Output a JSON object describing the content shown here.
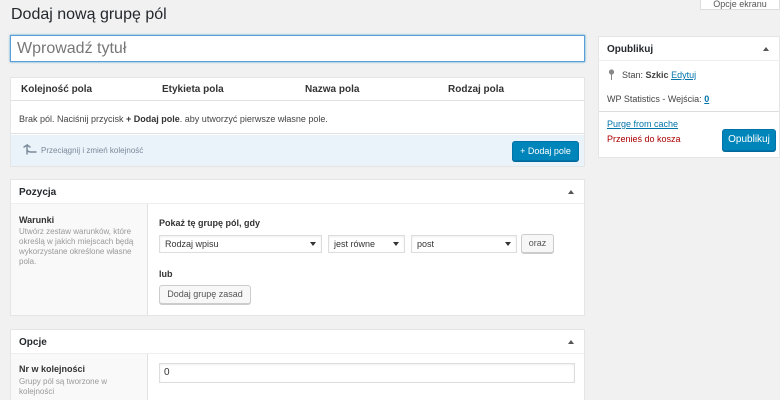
{
  "screen_options": "Opcje ekranu",
  "page_title": "Dodaj nową grupę pól",
  "title_input": {
    "placeholder": "Wprowadź tytuł"
  },
  "fields_table": {
    "columns": [
      "Kolejność pola",
      "Etykieta pola",
      "Nazwa pola",
      "Rodzaj pola"
    ],
    "empty_prefix": "Brak pól. Naciśnij przycisk ",
    "empty_bold": "+ Dodaj pole",
    "empty_suffix": ". aby utworzyć pierwsze własne pole.",
    "reorder_hint": "Przeciągnij i zmień kolejność",
    "add_button": "+ Dodaj pole"
  },
  "location": {
    "title": "Pozycja",
    "rules_label": "Warunki",
    "rules_desc": "Utwórz zestaw warunków, które określą w jakich miejscach będą wykorzystane określone własne pola.",
    "show_if": "Pokaż tę grupę pól, gdy",
    "param_select": "Rodzaj wpisu",
    "operator_select": "jest równe",
    "value_select": "post",
    "and_button": "oraz",
    "or_label": "lub",
    "add_group_button": "Dodaj grupę zasad"
  },
  "options": {
    "title": "Opcje",
    "order_label": "Nr w kolejności",
    "order_desc": "Grupy pól są tworzone w kolejności",
    "order_value": "0"
  },
  "publish": {
    "title": "Opublikuj",
    "status_label": "Stan:",
    "status_value": "Szkic",
    "status_edit": "Edytuj",
    "wp_stats_label": "WP Statistics - Wejścia:",
    "wp_stats_value": "0",
    "purge_link": "Purge from cache",
    "trash_link": "Przenieś do kosza",
    "publish_button": "Opublikuj"
  },
  "colors": {
    "primary": "#0085ba",
    "link": "#0073aa",
    "trash": "#a00000",
    "background": "#f1f1f1"
  }
}
